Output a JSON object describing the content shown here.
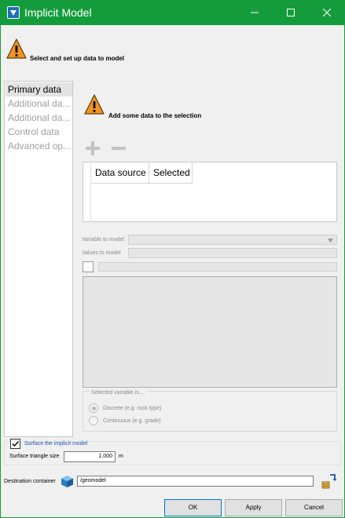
{
  "window": {
    "title": "Implicit Model",
    "icons": {
      "app": "app-icon",
      "minimize": "minimize-icon",
      "maximize": "maximize-icon",
      "close": "close-icon"
    }
  },
  "header": {
    "message": "Select and set up data to model",
    "icon": "warning-icon"
  },
  "nav": {
    "items": [
      {
        "label": "Primary data",
        "selected": true
      },
      {
        "label": "Additional da..."
      },
      {
        "label": "Additional da..."
      },
      {
        "label": "Control data"
      },
      {
        "label": "Advanced op..."
      }
    ]
  },
  "main": {
    "notice": "Add some data to the selection",
    "table": {
      "columns": [
        "Data source",
        "Selected"
      ]
    },
    "variable_label": "Variable to model",
    "values_label": "Values to model",
    "group": {
      "title": "Selected variable is....",
      "options": [
        {
          "label": "Discrete (e.g. rock type)",
          "checked": true
        },
        {
          "label": "Continuous (e.g. grade)",
          "checked": false
        }
      ]
    }
  },
  "surface": {
    "checkbox_label": "Surface the implicit model",
    "checked": true,
    "size_label": "Surface triangle size",
    "size_value": "1.000",
    "unit": "m"
  },
  "destination": {
    "label": "Destination container",
    "value": "/geomodel"
  },
  "buttons": {
    "ok": "OK",
    "apply": "Apply",
    "cancel": "Cancel"
  },
  "colors": {
    "titlebar": "#149c3c",
    "warning": "#f29423",
    "link": "#1b57a8",
    "accent": "#0078d7"
  }
}
